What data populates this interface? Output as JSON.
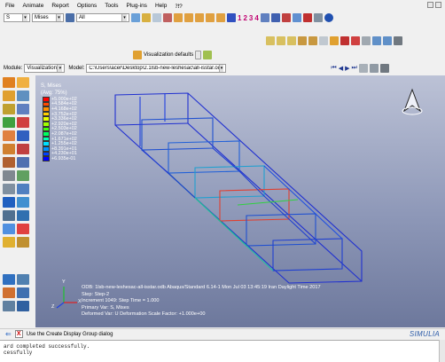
{
  "menu": [
    "File",
    "Animate",
    "Report",
    "Options",
    "Tools",
    "Plug-ins",
    "Help",
    "⁈?"
  ],
  "toolbar1": {
    "step_value": "S",
    "variable_value": "Mises",
    "all_value": "All",
    "numbers": [
      "1",
      "2",
      "3",
      "4"
    ]
  },
  "toolbar3": {
    "visualization_defaults": "Visualization defaults"
  },
  "context": {
    "module_label": "Module:",
    "module_value": "Visualization",
    "model_label": "Model:",
    "model_value": "C:\\Users\\acer\\Desktop\\2.1lsb-new-leshesac\\all-isstar.odb"
  },
  "legend": {
    "title": "S, Mises",
    "avg": "(Avg: 75%)",
    "values": [
      "+5.000e+02",
      "+4.584e+02",
      "+4.168e+02",
      "+3.752e+02",
      "+3.336e+02",
      "+2.920e+02",
      "+2.503e+02",
      "+2.087e+02",
      "+1.671e+02",
      "+1.255e+02",
      "+8.391e+01",
      "+4.230e+01",
      "+6.935e-01"
    ],
    "colors": [
      "#ff0000",
      "#ff4800",
      "#ff9000",
      "#ffd000",
      "#e8ff00",
      "#a0ff00",
      "#40ff10",
      "#00ff60",
      "#00ffb0",
      "#00e0ff",
      "#0090ff",
      "#0040ff",
      "#0000ff"
    ]
  },
  "info": {
    "line1": "ODB: 1lsb-new-leshesac-all-isstar.odb    Abaqus/Standard 6.14-1    Mon Jul 03 13:45:19 Iran Daylight Time 2017",
    "line2": "Step: Step-2",
    "line3": "Increment    1049: Step Time =    1.000",
    "line4": "Primary Var: S, Mises",
    "line5": "Deformed Var: U   Deformation Scale Factor: +1.000e+00"
  },
  "axis": {
    "y": "Y",
    "z": "Z",
    "x": "X"
  },
  "status": {
    "text": "Use the Create Display Group dialog"
  },
  "brand": "SIMULIA",
  "console": {
    "line1": "ard completed successfully.",
    "line2": "cessfully"
  }
}
